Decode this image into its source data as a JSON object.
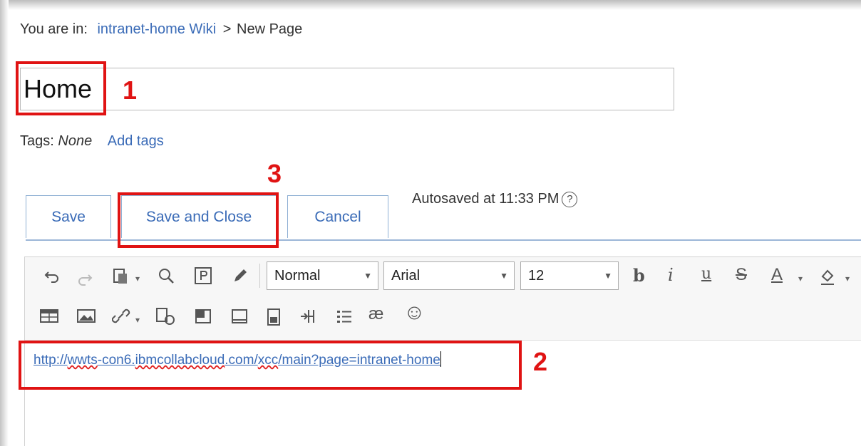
{
  "breadcrumb": {
    "prefix": "You are in:",
    "link": "intranet-home Wiki",
    "separator": ">",
    "current": "New Page"
  },
  "page": {
    "title": "Home"
  },
  "tags": {
    "label": "Tags:",
    "value": "None",
    "add_link": "Add tags"
  },
  "buttons": {
    "save": "Save",
    "save_close": "Save and Close",
    "cancel": "Cancel"
  },
  "autosave": {
    "text": "Autosaved at 11:33 PM",
    "help_glyph": "?"
  },
  "toolbar": {
    "style_select": "Normal",
    "font_select": "Arial",
    "size_select": "12",
    "icons_row1": [
      "undo-icon",
      "redo-icon",
      "paste-icon",
      "find-icon",
      "paragraph-icon",
      "edit-icon"
    ],
    "format_buttons": [
      "bold",
      "italic",
      "underline",
      "strikethrough",
      "font-color",
      "highlight-color"
    ],
    "format_glyphs": {
      "bold": "b",
      "italic": "i",
      "underline": "u",
      "strike": "S",
      "font_color": "A"
    },
    "icons_row2": [
      "table-icon",
      "image-icon",
      "link-icon",
      "special-paste-icon",
      "block-icon",
      "frame-icon",
      "form-icon",
      "split-icon",
      "list-icon",
      "ligature-icon",
      "emoji-icon"
    ],
    "ligature_glyph": "æ",
    "emoji_glyph": "☺"
  },
  "editor": {
    "url_parts": {
      "p1": "http://",
      "p2": "wwts",
      "p3": "-con6.",
      "p4": "ibmcollabcloud",
      "p5": ".com/",
      "p6": "xcc",
      "p7": "/main?page=intranet-home"
    }
  },
  "annotations": {
    "one": "1",
    "two": "2",
    "three": "3"
  },
  "colors": {
    "link": "#3a6bb7",
    "annotation": "#e01313",
    "tab_border": "#8fb0d4"
  }
}
